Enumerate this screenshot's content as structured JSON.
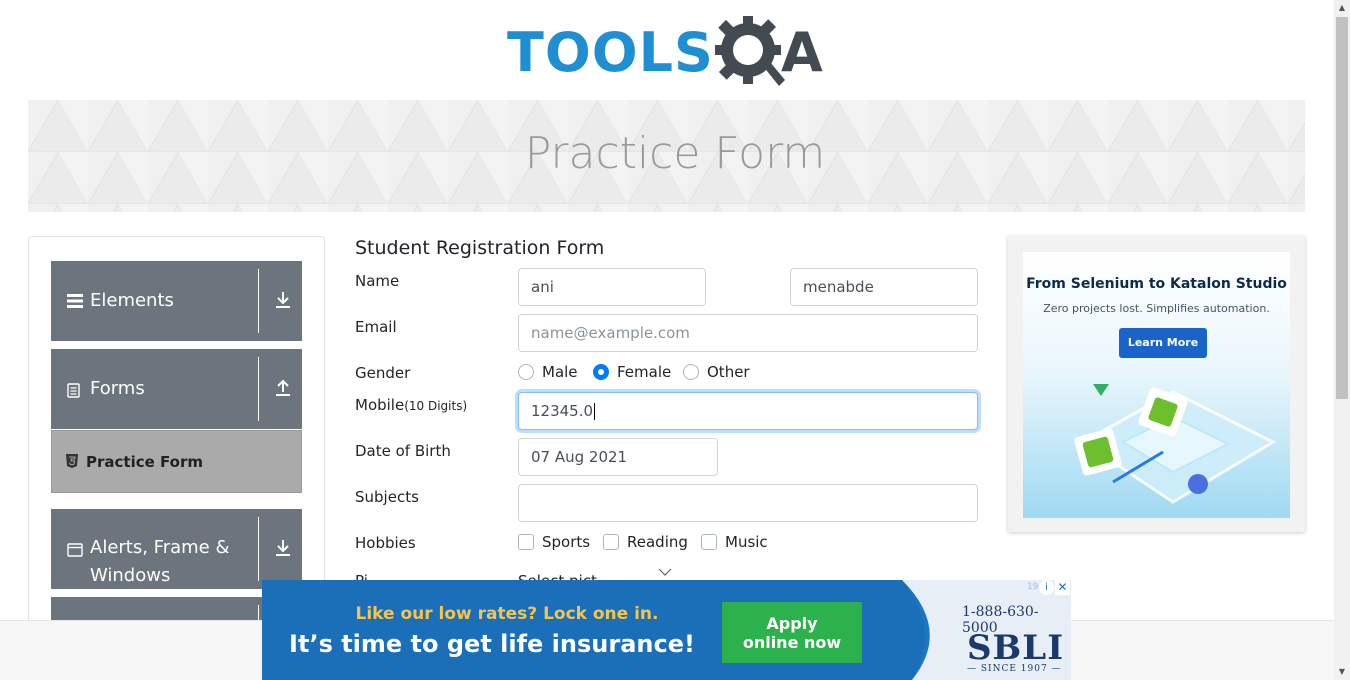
{
  "logo": {
    "text_left": "TOOLS",
    "text_right": "A"
  },
  "banner": {
    "title": "Practice Form"
  },
  "sidebar": {
    "groups": [
      {
        "label": "Elements",
        "icon": "hamburger-icon",
        "arrow": "download-arrow-icon"
      },
      {
        "label": "Forms",
        "icon": "document-icon",
        "arrow": "upload-arrow-icon"
      },
      {
        "label": "Alerts, Frame &",
        "label_line2": "Windows",
        "icon": "window-icon",
        "arrow": "download-arrow-icon"
      }
    ],
    "active_item": {
      "label": "Practice Form",
      "icon": "html5-icon"
    }
  },
  "form": {
    "title": "Student Registration Form",
    "name_label": "Name",
    "first_name": "ani",
    "last_name": "menabde",
    "email_label": "Email",
    "email_placeholder": "name@example.com",
    "gender_label": "Gender",
    "gender_options": [
      "Male",
      "Female",
      "Other"
    ],
    "gender_selected": "Female",
    "mobile_label": "Mobile",
    "mobile_hint": "(10 Digits)",
    "mobile_value": "12345.0",
    "dob_label": "Date of Birth",
    "dob_value": "07 Aug 2021",
    "subjects_label": "Subjects",
    "hobbies_label": "Hobbies",
    "hobbies": [
      "Sports",
      "Reading",
      "Music"
    ],
    "picture_label_partial": "Pi",
    "picture_select_partial": "Select pict"
  },
  "side_ad": {
    "headline": "From Selenium to Katalon Studio",
    "subline": "Zero projects lost. Simplifies automation.",
    "button": "Learn More"
  },
  "bottom_ad": {
    "line1": "Like our low rates? Lock one in.",
    "line2": "It’s time to get life insurance!",
    "button_line1": "Apply",
    "button_line2": "online now",
    "phone": "1-888-630-5000",
    "brand": "SBLI",
    "since": "— SINCE 1907 —",
    "tiny": "19"
  },
  "colors": {
    "accent": "#007bff",
    "sidebar_group": "#6c757d",
    "logo_blue": "#1f8fd1",
    "ad_blue": "#1b77c4",
    "ad_green": "#2bb24c"
  }
}
